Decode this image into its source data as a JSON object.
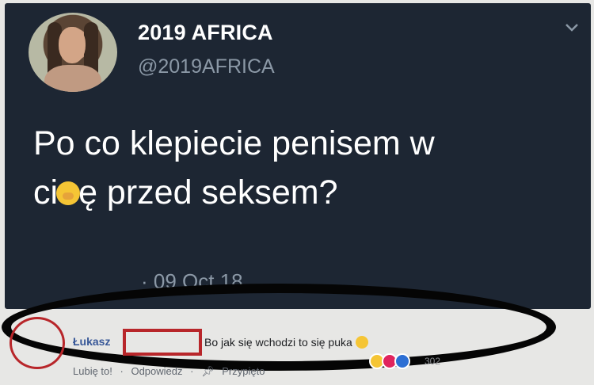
{
  "tweet": {
    "account_name": "2019 AFRICA",
    "handle": "@2019AFRICA",
    "text_line1": "Po co klepiecie penisem w",
    "text_line2_a": "ci",
    "text_line2_b": "ę przed seksem?",
    "timestamp": "· 09 Oct 18"
  },
  "comment": {
    "author": "Łukasz",
    "text": "Bo jak się wchodzi to się puka",
    "actions": [
      "Lubię to!",
      "·",
      "Odpowiedz",
      "·",
      "Przypięto"
    ],
    "reaction_count": "302"
  },
  "colors": {
    "tweet_bg": "#1d2633",
    "annotation_red": "#b8262a",
    "annotation_black": "#050505"
  }
}
